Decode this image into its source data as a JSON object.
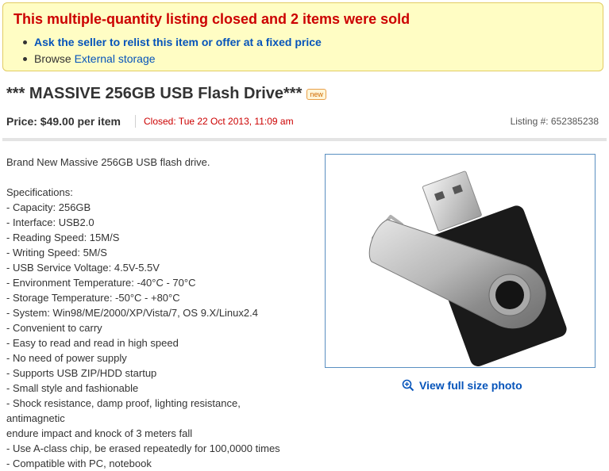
{
  "notice": {
    "title": "This multiple-quantity listing closed and 2 items were sold",
    "relist_link": "Ask the seller to relist this item or offer at a fixed price",
    "browse_prefix": "Browse",
    "browse_link": "External storage"
  },
  "item": {
    "title": "*** MASSIVE 256GB USB Flash Drive***",
    "badge": "new",
    "price": "Price: $49.00 per item",
    "closed": "Closed: Tue 22 Oct 2013, 11:09 am",
    "listing": "Listing #: 652385238"
  },
  "description": {
    "intro": "Brand New Massive 256GB USB flash drive.",
    "spec_heading": "Specifications:",
    "lines": [
      "- Capacity: 256GB",
      "- Interface: USB2.0",
      "- Reading Speed: 15M/S",
      "- Writing Speed: 5M/S",
      "- USB Service Voltage: 4.5V-5.5V",
      "- Environment Temperature: -40°C - 70°C",
      "- Storage Temperature: -50°C - +80°C",
      "- System: Win98/ME/2000/XP/Vista/7, OS 9.X/Linux2.4",
      "- Convenient to carry",
      "- Easy to read and read in high speed",
      "- No need of power supply",
      "- Supports USB ZIP/HDD startup",
      "- Small style and fashionable",
      "- Shock resistance, damp proof, lighting resistance, antimagnetic",
      "endure impact and knock of 3 meters fall",
      "- Use A-class chip, be erased repeatedly for 100,0000 times",
      "- Compatible with PC, notebook"
    ]
  },
  "photo": {
    "view_full_label": "View full size photo",
    "icon": "zoom-in-icon"
  },
  "colors": {
    "notice_bg": "#fffdc4",
    "notice_title": "#cc0000",
    "link": "#0654ba",
    "photo_border": "#5a8fc1"
  }
}
